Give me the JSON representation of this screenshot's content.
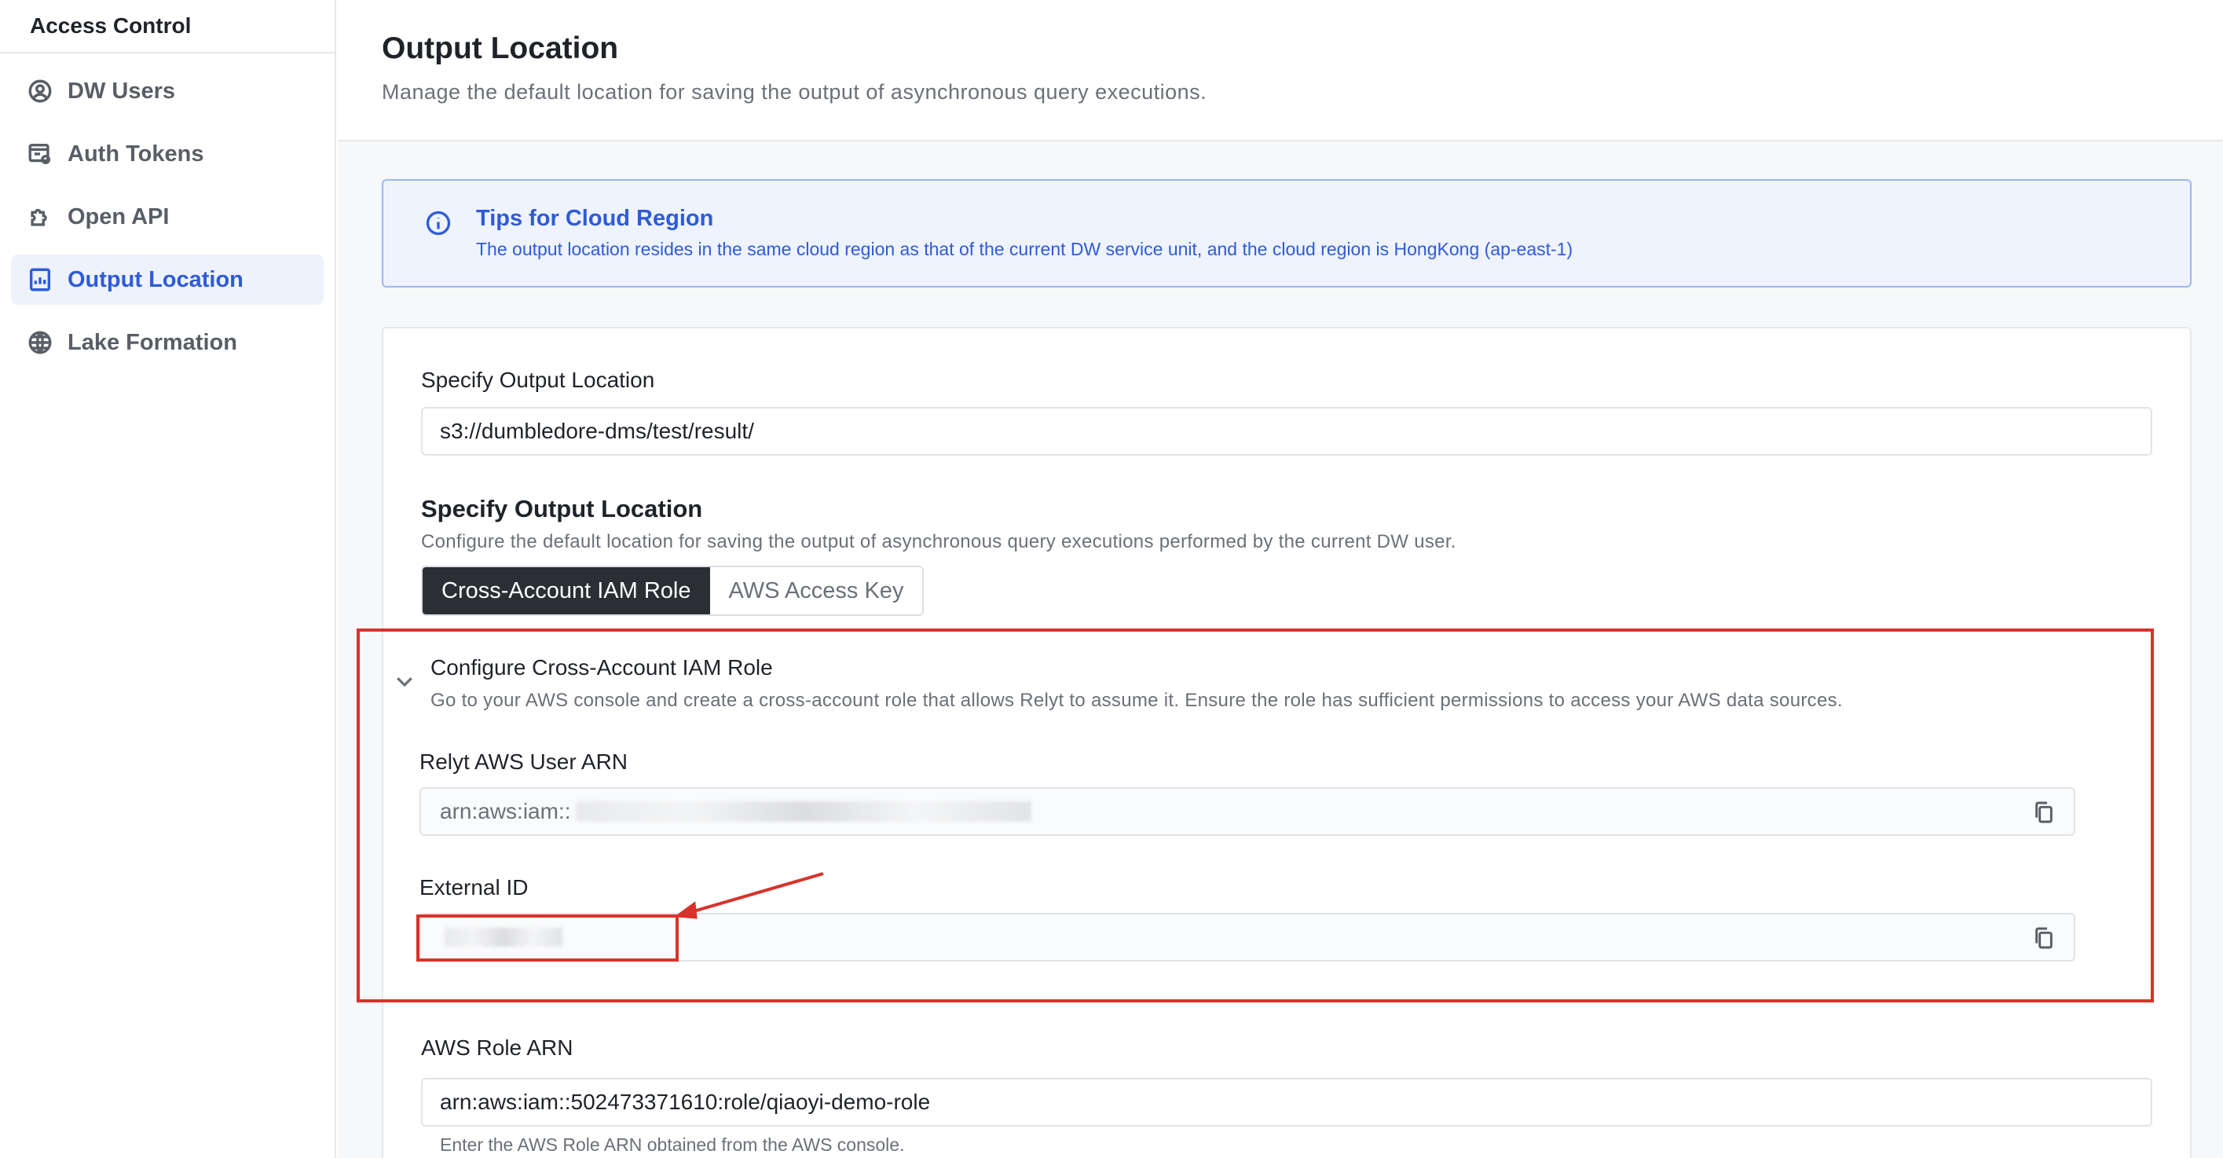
{
  "sidebar": {
    "header": "Access Control",
    "items": [
      {
        "label": "DW Users",
        "icon": "user-circle-icon"
      },
      {
        "label": "Auth Tokens",
        "icon": "token-icon"
      },
      {
        "label": "Open API",
        "icon": "puzzle-icon"
      },
      {
        "label": "Output Location",
        "icon": "report-icon",
        "active": true
      },
      {
        "label": "Lake Formation",
        "icon": "globe-icon"
      }
    ]
  },
  "page": {
    "title": "Output Location",
    "subtitle": "Manage the default location for saving the output of asynchronous query executions."
  },
  "tips": {
    "title": "Tips for Cloud Region",
    "text": "The output location resides in the same cloud region as that of the current DW service unit, and the cloud region is HongKong (ap-east-1)"
  },
  "form": {
    "output_location_label": "Specify Output Location",
    "output_location_value": "s3://dumbledore-dms/test/result/",
    "section_title": "Specify Output Location",
    "section_desc": "Configure the default location for saving the output of asynchronous query executions performed by the current DW user.",
    "tabs": [
      {
        "label": "Cross-Account IAM Role",
        "active": true
      },
      {
        "label": "AWS Access Key",
        "active": false
      }
    ],
    "cross_account": {
      "title": "Configure Cross-Account IAM Role",
      "desc": "Go to your AWS console and create a cross-account role that allows Relyt to assume it. Ensure the role has sufficient permissions to access your AWS data sources.",
      "user_arn_label": "Relyt AWS User ARN",
      "user_arn_prefix": "arn:aws:iam::",
      "external_id_label": "External ID"
    },
    "role_arn_label": "AWS Role ARN",
    "role_arn_value": "arn:aws:iam::502473371610:role/qiaoyi-demo-role",
    "role_arn_hint": "Enter the AWS Role ARN obtained from the AWS console."
  },
  "colors": {
    "accent": "#2f5bd8",
    "highlight": "#d9322b",
    "active_nav_bg": "#eef2fd"
  }
}
